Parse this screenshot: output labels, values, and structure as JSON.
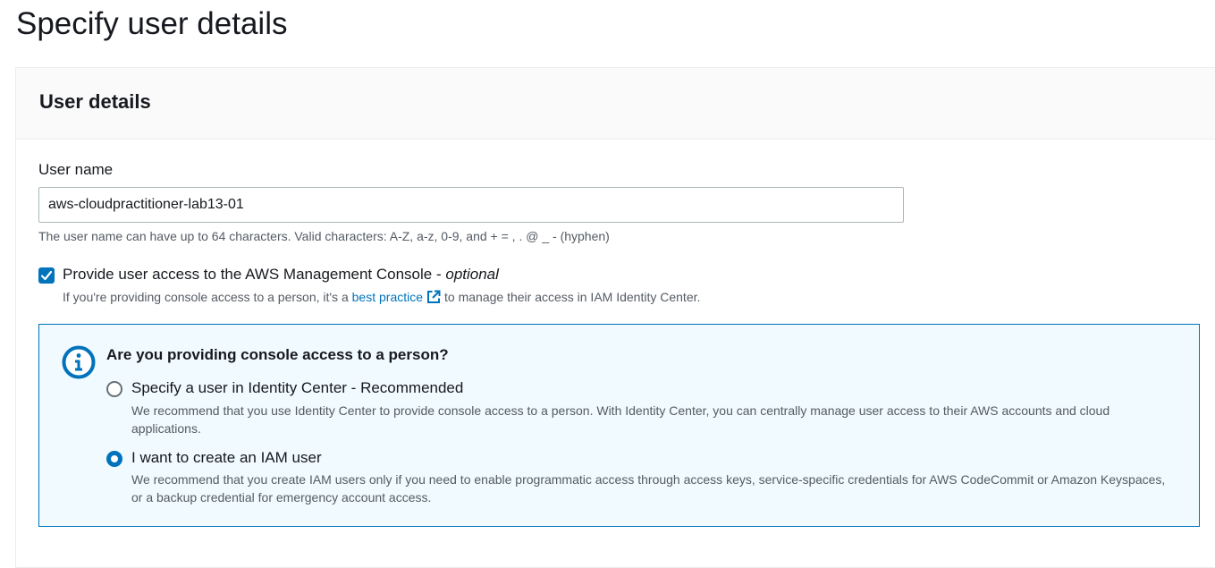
{
  "page": {
    "title": "Specify user details"
  },
  "panel": {
    "title": "User details"
  },
  "user_name": {
    "label": "User name",
    "value": "aws-cloudpractitioner-lab13-01",
    "hint": "The user name can have up to 64 characters. Valid characters: A-Z, a-z, 0-9, and + = , . @ _ - (hyphen)"
  },
  "console_access": {
    "checked": true,
    "label": "Provide user access to the AWS Management Console - ",
    "label_optional": "optional",
    "desc_before": "If you're providing console access to a person, it's a ",
    "desc_link": "best practice",
    "desc_after": "to manage their access in IAM Identity Center."
  },
  "info_box": {
    "title": "Are you providing console access to a person?",
    "options": [
      {
        "label": "Specify a user in Identity Center - Recommended",
        "desc": "We recommend that you use Identity Center to provide console access to a person. With Identity Center, you can centrally manage user access to their AWS accounts and cloud applications.",
        "selected": false
      },
      {
        "label": "I want to create an IAM user",
        "desc": "We recommend that you create IAM users only if you need to enable programmatic access through access keys, service-specific credentials for AWS CodeCommit or Amazon Keyspaces, or a backup credential for emergency account access.",
        "selected": true
      }
    ]
  },
  "icons": {
    "check": "check-icon",
    "external_link": "external-link-icon",
    "info": "info-icon"
  },
  "colors": {
    "accent": "#0073bb",
    "info_background": "#f1faff",
    "secondary_text": "#545b64",
    "primary_text": "#16191f"
  }
}
